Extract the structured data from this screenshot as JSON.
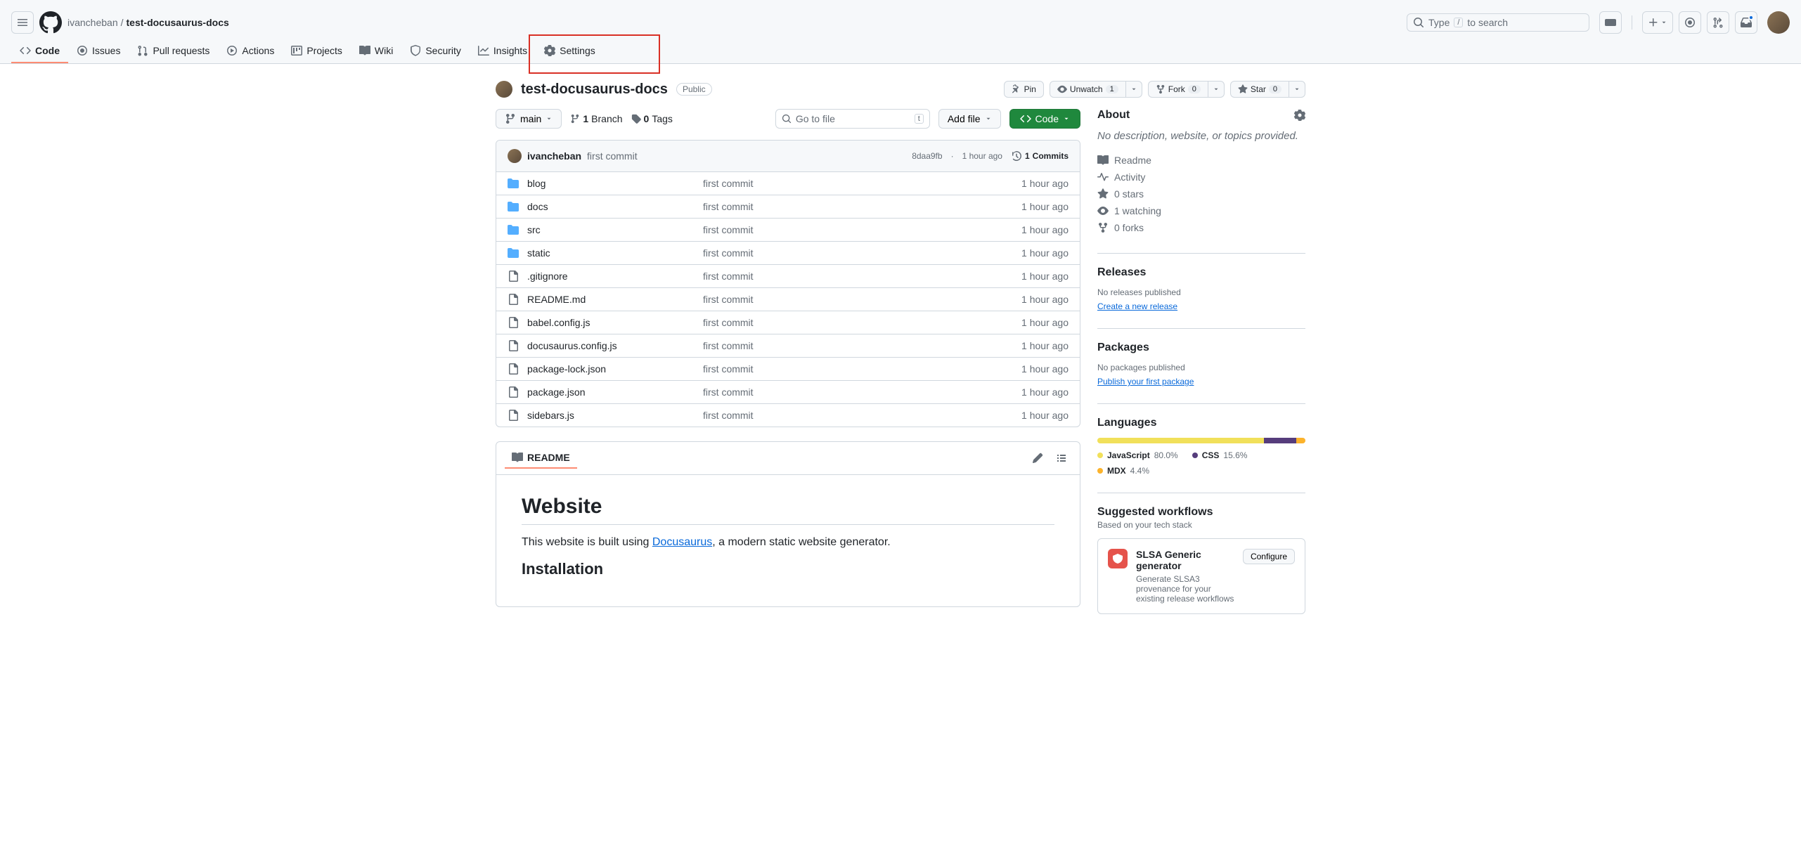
{
  "header": {
    "owner": "ivancheban",
    "repo": "test-docusaurus-docs",
    "search_prefix": "Type",
    "search_key": "/",
    "search_suffix": "to search"
  },
  "nav": {
    "code": "Code",
    "issues": "Issues",
    "pulls": "Pull requests",
    "actions": "Actions",
    "projects": "Projects",
    "wiki": "Wiki",
    "security": "Security",
    "insights": "Insights",
    "settings": "Settings"
  },
  "repo": {
    "name": "test-docusaurus-docs",
    "visibility": "Public",
    "pin": "Pin",
    "unwatch": "Unwatch",
    "unwatch_count": "1",
    "fork": "Fork",
    "fork_count": "0",
    "star": "Star",
    "star_count": "0"
  },
  "branches": {
    "current": "main",
    "branch_count": "1",
    "branch_label": "Branch",
    "tag_count": "0",
    "tag_label": "Tags",
    "goto_placeholder": "Go to file",
    "goto_key": "t",
    "add_file": "Add file",
    "code_btn": "Code"
  },
  "commit": {
    "author": "ivancheban",
    "message": "first commit",
    "sha": "8daa9fb",
    "time": "1 hour ago",
    "count": "1",
    "count_label": "Commits"
  },
  "files": [
    {
      "type": "dir",
      "name": "blog",
      "msg": "first commit",
      "time": "1 hour ago"
    },
    {
      "type": "dir",
      "name": "docs",
      "msg": "first commit",
      "time": "1 hour ago"
    },
    {
      "type": "dir",
      "name": "src",
      "msg": "first commit",
      "time": "1 hour ago"
    },
    {
      "type": "dir",
      "name": "static",
      "msg": "first commit",
      "time": "1 hour ago"
    },
    {
      "type": "file",
      "name": ".gitignore",
      "msg": "first commit",
      "time": "1 hour ago"
    },
    {
      "type": "file",
      "name": "README.md",
      "msg": "first commit",
      "time": "1 hour ago"
    },
    {
      "type": "file",
      "name": "babel.config.js",
      "msg": "first commit",
      "time": "1 hour ago"
    },
    {
      "type": "file",
      "name": "docusaurus.config.js",
      "msg": "first commit",
      "time": "1 hour ago"
    },
    {
      "type": "file",
      "name": "package-lock.json",
      "msg": "first commit",
      "time": "1 hour ago"
    },
    {
      "type": "file",
      "name": "package.json",
      "msg": "first commit",
      "time": "1 hour ago"
    },
    {
      "type": "file",
      "name": "sidebars.js",
      "msg": "first commit",
      "time": "1 hour ago"
    }
  ],
  "readme": {
    "tab": "README",
    "h1": "Website",
    "p_pre": "This website is built using ",
    "p_link": "Docusaurus",
    "p_post": ", a modern static website generator.",
    "h2": "Installation"
  },
  "sidebar": {
    "about": "About",
    "desc": "No description, website, or topics provided.",
    "readme": "Readme",
    "activity": "Activity",
    "stars": "0 stars",
    "watching": "1 watching",
    "forks": "0 forks",
    "releases": "Releases",
    "no_releases": "No releases published",
    "create_release": "Create a new release",
    "packages": "Packages",
    "no_packages": "No packages published",
    "publish_package": "Publish your first package",
    "languages": "Languages",
    "lang_items": [
      {
        "name": "JavaScript",
        "pct": "80.0%",
        "color": "#f1e05a"
      },
      {
        "name": "CSS",
        "pct": "15.6%",
        "color": "#563d7c"
      },
      {
        "name": "MDX",
        "pct": "4.4%",
        "color": "#fcb32c"
      }
    ],
    "workflows_title": "Suggested workflows",
    "workflows_sub": "Based on your tech stack",
    "wf_name": "SLSA Generic generator",
    "wf_desc": "Generate SLSA3 provenance for your existing release workflows",
    "wf_btn": "Configure"
  }
}
